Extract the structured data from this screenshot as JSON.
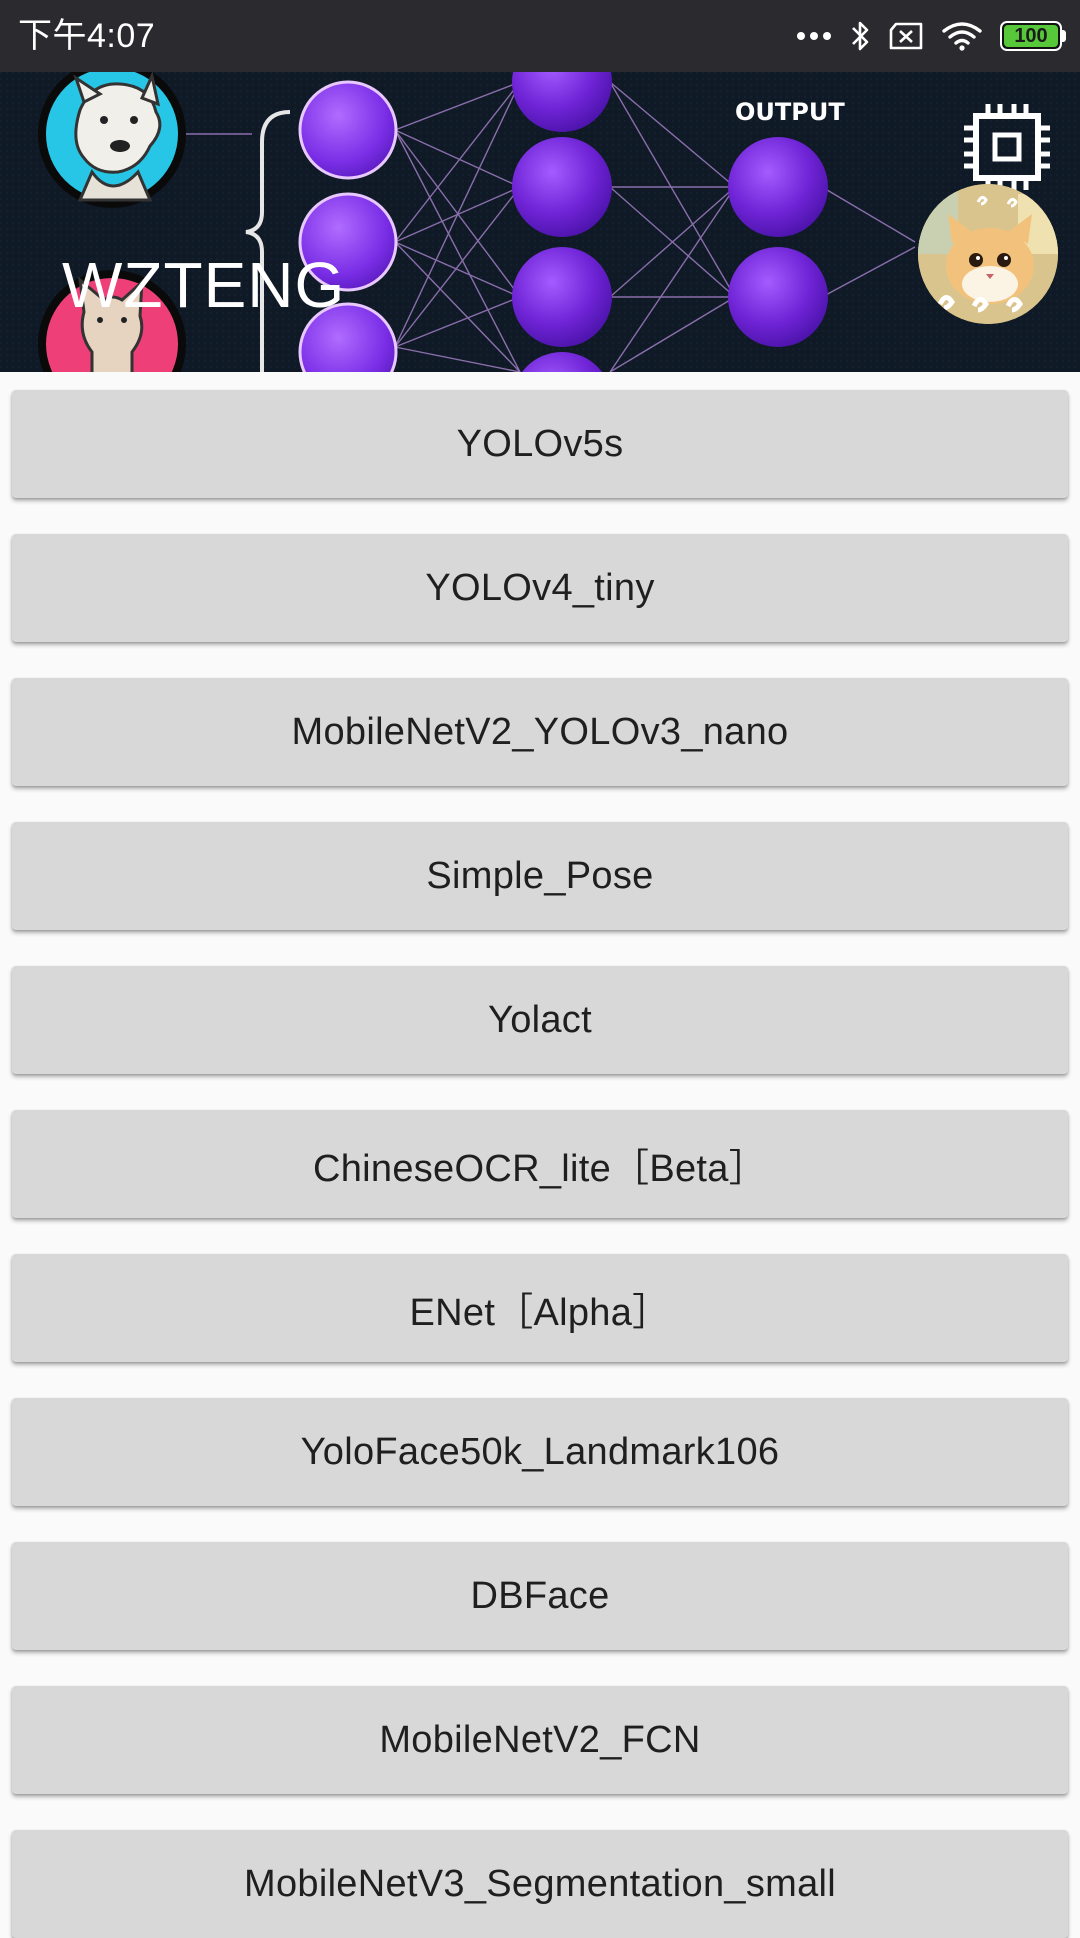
{
  "status_bar": {
    "time": "下午4:07",
    "battery_level": "100",
    "icons": [
      "more-dots-icon",
      "bluetooth-icon",
      "no-sim-icon",
      "wifi-icon",
      "battery-icon"
    ]
  },
  "header": {
    "title": "WZTENG",
    "banner_label": "OUTPUT",
    "icons": [
      "dog-avatar-icon",
      "cat-avatar-icon",
      "neural-network-graphic",
      "chip-icon",
      "cat-photo-avatar"
    ],
    "colors": {
      "banner_bg": "#0f1a26",
      "node_purple": "#7d2fe0",
      "dog_circle": "#28c6e6",
      "cat_circle": "#ee3f78"
    }
  },
  "menu": {
    "items": [
      {
        "label": "YOLOv5s"
      },
      {
        "label": "YOLOv4_tiny"
      },
      {
        "label": "MobileNetV2_YOLOv3_nano"
      },
      {
        "label": "Simple_Pose"
      },
      {
        "label": "Yolact"
      },
      {
        "label": "ChineseOCR_lite［Beta］"
      },
      {
        "label": "ENet［Alpha］"
      },
      {
        "label": "YoloFace50k_Landmark106"
      },
      {
        "label": "DBFace"
      },
      {
        "label": "MobileNetV2_FCN"
      },
      {
        "label": "MobileNetV3_Segmentation_small"
      }
    ]
  },
  "colors": {
    "status_bar_bg": "#2b2b2f",
    "button_bg": "#d8d8d8",
    "page_bg": "#fafafa",
    "battery_green": "#57c83a"
  }
}
